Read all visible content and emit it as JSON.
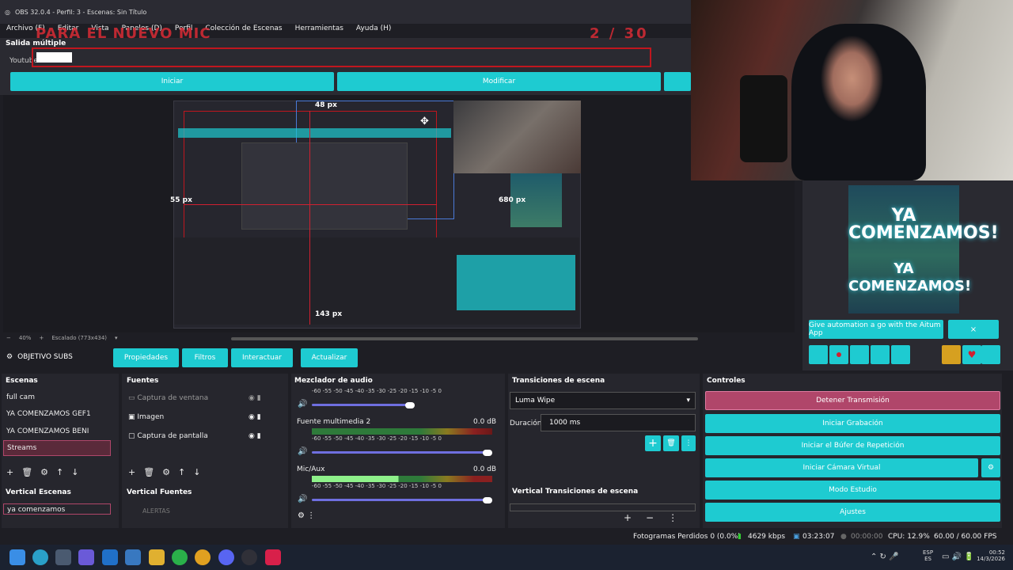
{
  "window": {
    "title": "OBS 32.0.4 - Perfil: 3 - Escenas: Sin Título"
  },
  "menu": [
    "Archivo (F)",
    "Editar",
    "Vista",
    "Paneles (D)",
    "Perfil",
    "Colección de Escenas",
    "Herramientas",
    "Ayuda (H)"
  ],
  "overlay": {
    "text": "PARA EL NUEVO MIC",
    "count": "2 / 30"
  },
  "salida": {
    "title": "Salida múltiple",
    "row_label": "Youtube",
    "buttons": [
      "Iniciar",
      "Modificar"
    ]
  },
  "preview": {
    "labels": {
      "top": "48 px",
      "left": "55 px",
      "right": "680 px",
      "bottom": "143 px"
    }
  },
  "zoom": {
    "level": "40%",
    "scaled": "Escalado (773x434)"
  },
  "sidepanel": {
    "yc_text": "YA COMENZAMOS!",
    "automation": "Give automation a go with the Aitum App",
    "close": "×"
  },
  "toolbar": {
    "source": "OBJETIVO SUBS",
    "buttons": [
      "Propiedades",
      "Filtros",
      "Interactuar",
      "Actualizar"
    ]
  },
  "scenes": {
    "title": "Escenas",
    "items": [
      "full cam",
      "YA COMENZAMOS GEF1",
      "YA COMENZAMOS BENI",
      "Streams"
    ],
    "vertical_title": "Vertical Escenas",
    "vertical_item": "ya comenzamos"
  },
  "sources": {
    "title": "Fuentes",
    "items": [
      "Captura de ventana",
      "Imagen",
      "Captura de pantalla"
    ],
    "vertical_title": "Vertical Fuentes",
    "vertical_item": "ALERTAS"
  },
  "mixer": {
    "title": "Mezclador de audio",
    "ticks": "-60 -55 -50 -45 -40 -35 -30 -25 -20 -15 -10 -5 0",
    "channels": [
      {
        "name": "Fuente multimedia 2",
        "db": "0.0 dB"
      },
      {
        "name": "Mic/Aux",
        "db": "0.0 dB"
      }
    ]
  },
  "transitions": {
    "title": "Transiciones de escena",
    "selected": "Luma Wipe",
    "duration_label": "Duración",
    "duration": "1000 ms",
    "vertical_title": "Vertical Transiciones de escena"
  },
  "controls": {
    "title": "Controles",
    "buttons": [
      "Detener Transmisión",
      "Iniciar Grabación",
      "Iniciar el Búfer de Repetición",
      "Iniciar Cámara Virtual",
      "Modo Estudio",
      "Ajustes"
    ]
  },
  "status": {
    "frames": "Fotogramas Perdidos 0 (0.0%)",
    "kbps": "4629 kbps",
    "stream_time": "03:23:07",
    "rec_time": "00:00:00",
    "cpu": "CPU: 12.9%",
    "fps": "60.00 / 60.00 FPS"
  },
  "taskbar": {
    "lang1": "ESP",
    "lang2": "ES",
    "time": "00:52",
    "date": "14/3/2026"
  },
  "colors": {
    "teal": "#1ecbd1",
    "stop": "#b0466a",
    "red_overlay": "#d02030"
  }
}
